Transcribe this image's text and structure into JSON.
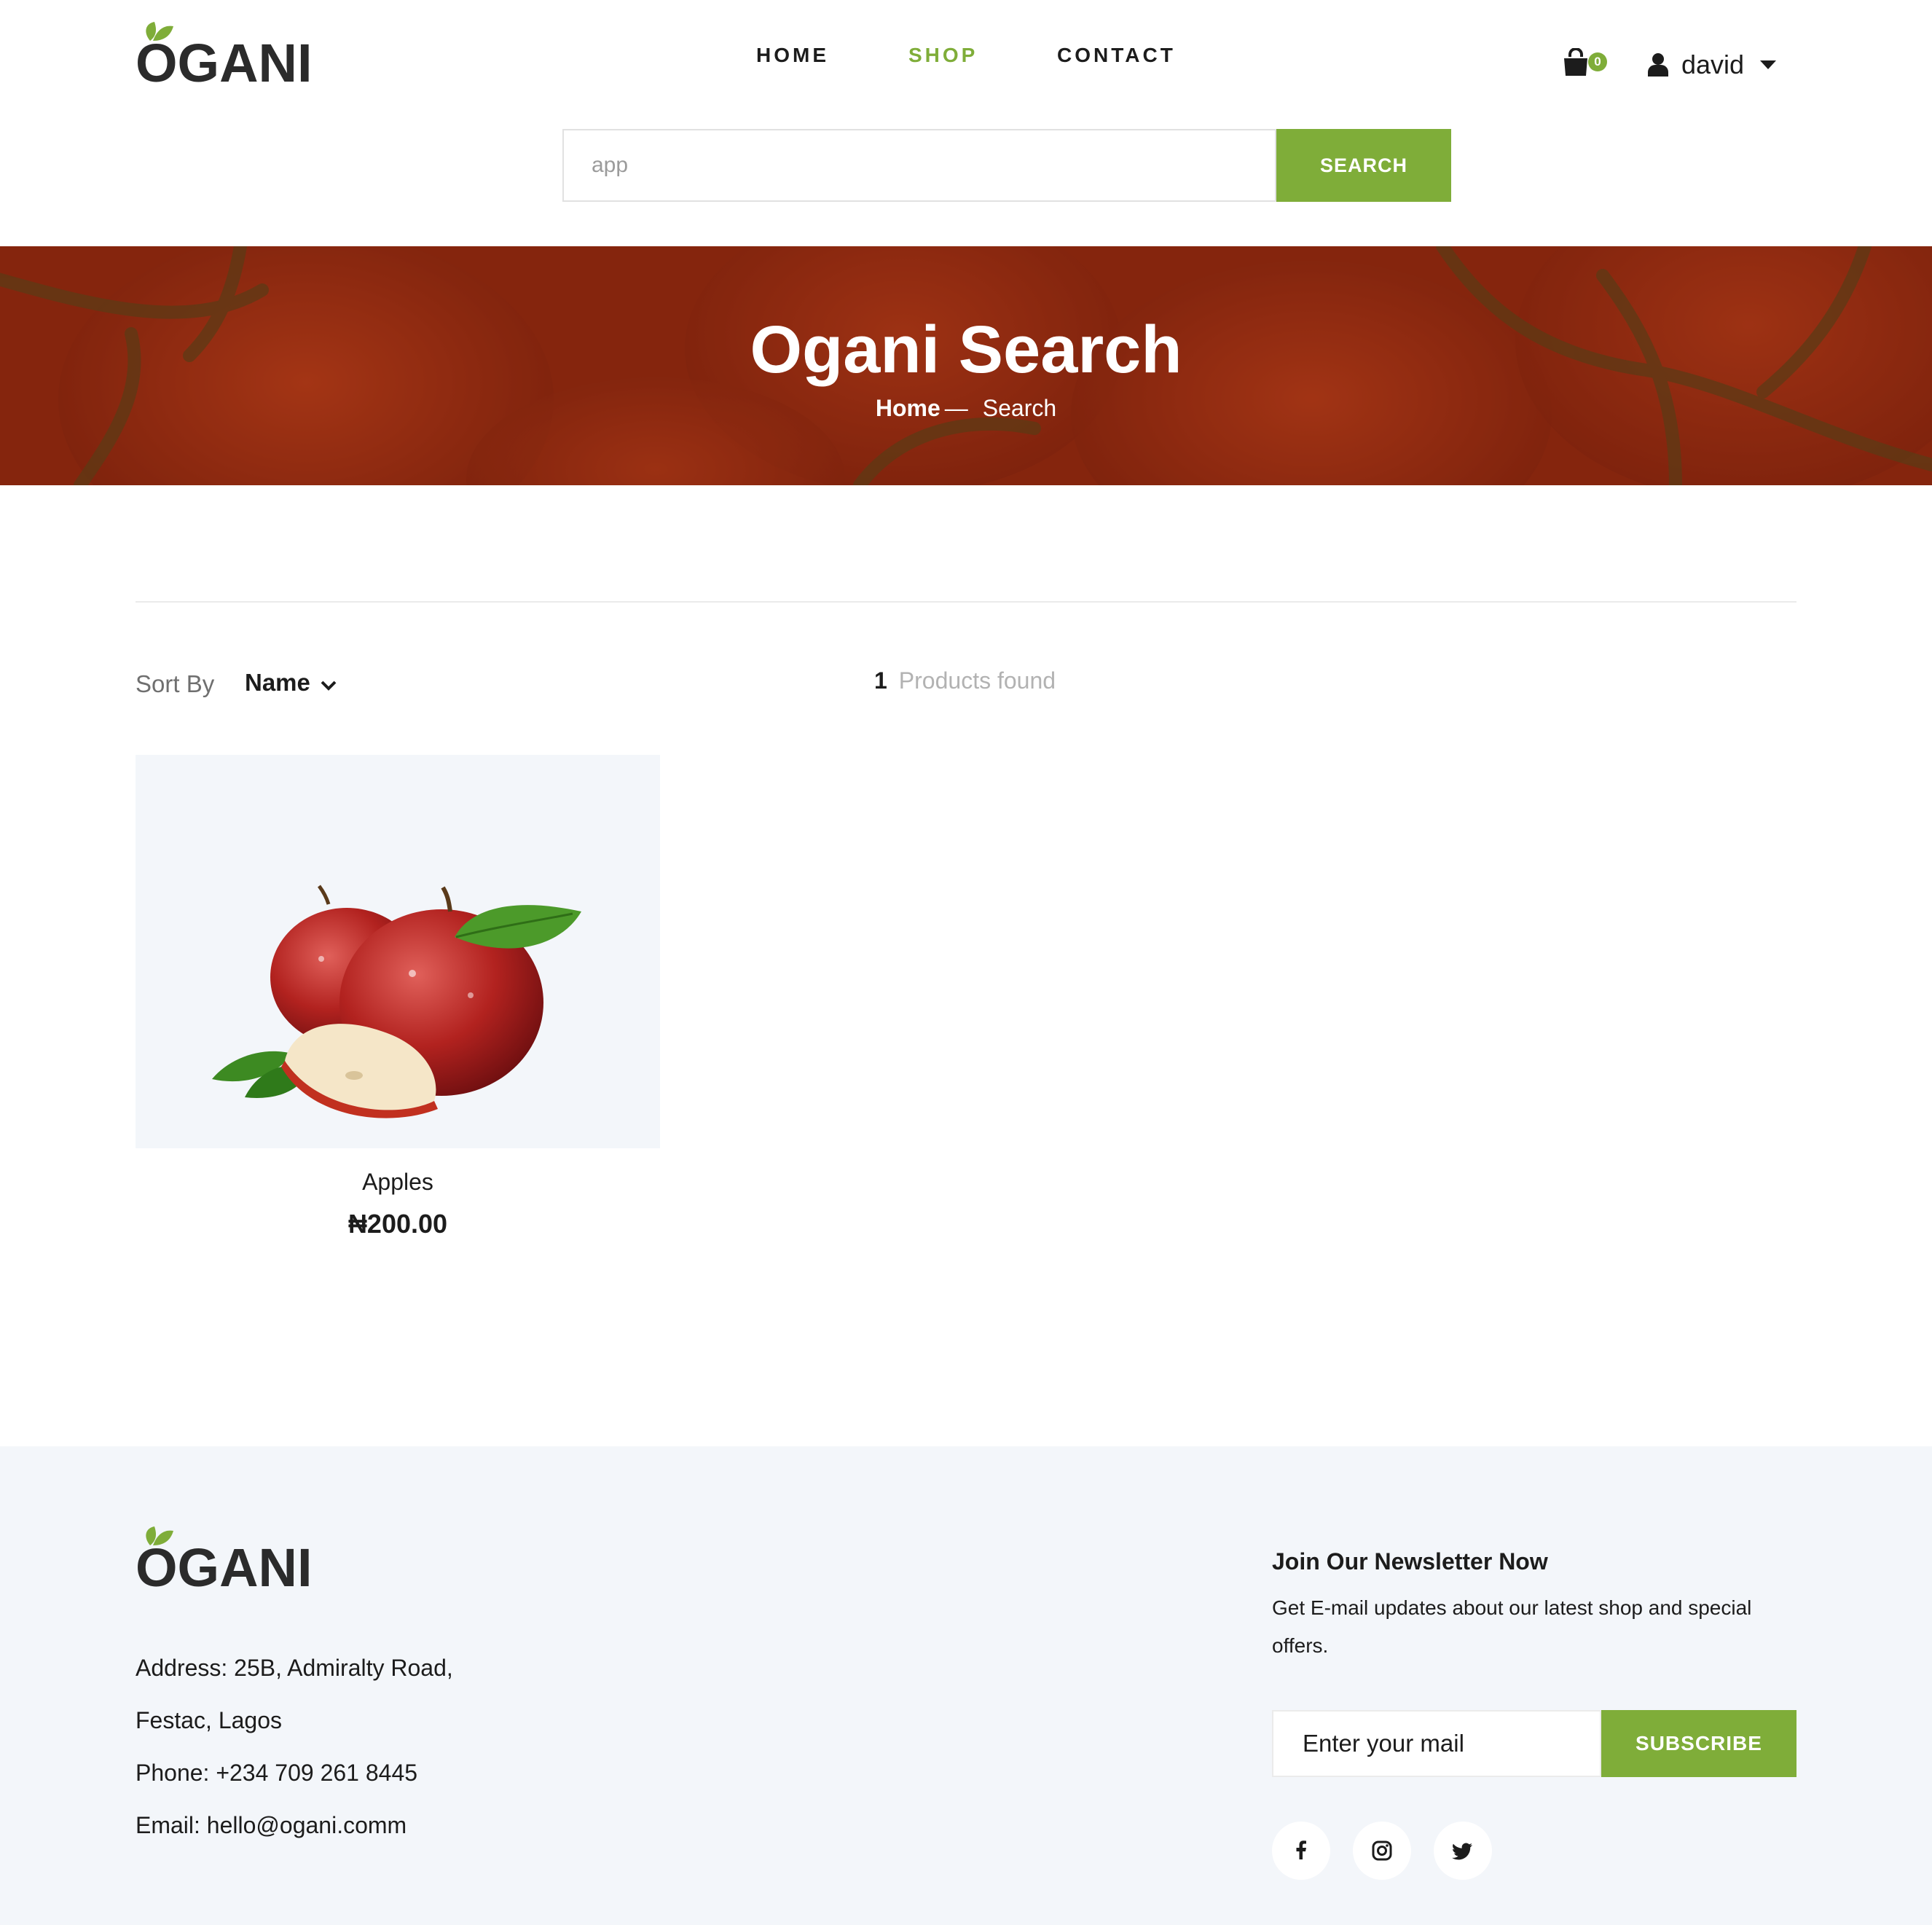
{
  "brand": {
    "name": "OGANI"
  },
  "nav": {
    "items": [
      {
        "label": "HOME",
        "active": false
      },
      {
        "label": "SHOP",
        "active": true
      },
      {
        "label": "CONTACT",
        "active": false
      }
    ]
  },
  "cart": {
    "count": "0",
    "icon": "shopping-bag-icon"
  },
  "user": {
    "name": "david",
    "icon": "user-icon"
  },
  "search": {
    "value": "app",
    "button": "SEARCH"
  },
  "hero": {
    "title": "Ogani Search",
    "breadcrumb": {
      "home": "Home",
      "separator": "—",
      "current": "Search"
    }
  },
  "toolbar": {
    "sort_label": "Sort By",
    "sort_value": "Name",
    "found_count": "1",
    "found_text": "Products found"
  },
  "products": [
    {
      "name": "Apples",
      "price": "₦200.00"
    }
  ],
  "footer": {
    "address_line1": "Address: 25B, Admiralty Road,",
    "address_line2": "Festac, Lagos",
    "phone": "Phone: +234 709 261 8445",
    "email": "Email: hello@ogani.comm",
    "newsletter_title": "Join Our Newsletter Now",
    "newsletter_text": "Get E-mail updates about our latest shop and special offers.",
    "newsletter_placeholder": "Enter your mail",
    "subscribe_button": "SUBSCRIBE",
    "social": [
      "facebook-icon",
      "instagram-icon",
      "twitter-icon"
    ]
  },
  "colors": {
    "accent": "#7fad39",
    "text": "#1c1c1c",
    "muted": "#b2b2b2",
    "footer_bg": "#f3f6fa"
  }
}
